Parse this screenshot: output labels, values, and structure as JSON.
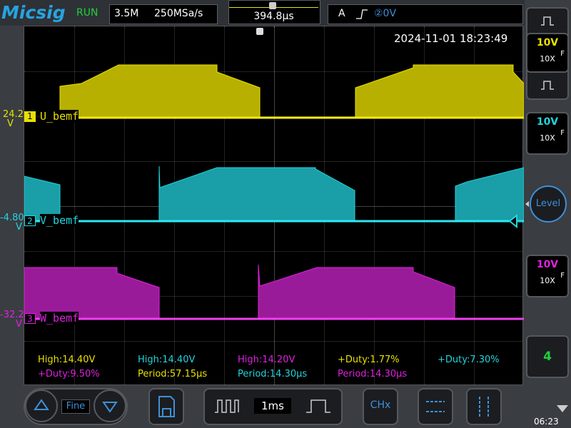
{
  "header": {
    "logo": "Micsig",
    "status": "RUN",
    "memory_depth": "3.5M",
    "sample_rate": "250MSa/s",
    "time_offset": "394.8µs",
    "trigger_mode": "A",
    "trigger_source": "②0V"
  },
  "timestamp": "2024-11-01 18:23:49",
  "channels": [
    {
      "num": "1",
      "name": "U_bemf",
      "offset": "24.2",
      "unit": "V",
      "color": "#e8e000",
      "scale": "10V",
      "coupling": "F",
      "probe": "10X"
    },
    {
      "num": "2",
      "name": "V_bemf",
      "offset": "-4.80",
      "unit": "V",
      "color": "#22d4de",
      "scale": "10V",
      "coupling": "F",
      "probe": "10X"
    },
    {
      "num": "3",
      "name": "W_bemf",
      "offset": "-32.2",
      "unit": "V",
      "color": "#e020e0",
      "scale": "10V",
      "coupling": "F",
      "probe": "10X"
    }
  ],
  "measurements": {
    "row1": [
      {
        "text": "High:14.40V",
        "color": "#e8e000"
      },
      {
        "text": "High:14.40V",
        "color": "#22d4de"
      },
      {
        "text": "High:14.20V",
        "color": "#e020e0"
      },
      {
        "text": "+Duty:1.77%",
        "color": "#e8e000"
      },
      {
        "text": "+Duty:7.30%",
        "color": "#22d4de"
      }
    ],
    "row2": [
      {
        "text": "+Duty:9.50%",
        "color": "#e020e0"
      },
      {
        "text": "Period:57.15µs",
        "color": "#e8e000"
      },
      {
        "text": "Period:14.30µs",
        "color": "#22d4de"
      },
      {
        "text": "Period:14.30µs",
        "color": "#e020e0"
      }
    ]
  },
  "right_panel": {
    "level_label": "Level",
    "channel_count": "4"
  },
  "bottom": {
    "fine_label": "Fine",
    "timebase": "1ms",
    "chx_label": "CHx",
    "clock": "06:23"
  }
}
